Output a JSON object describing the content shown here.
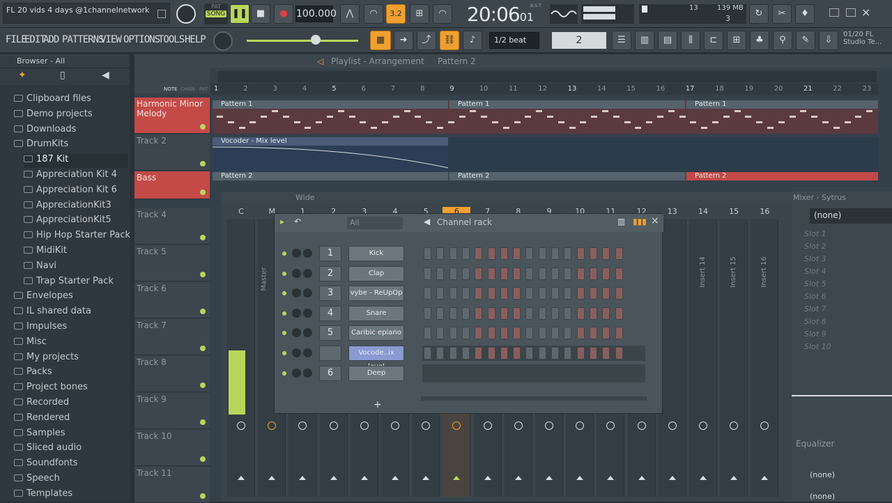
{
  "window": {
    "title": "FL 20 vids 4 days @1channelnetwork"
  },
  "transport": {
    "pat_label": "PAT",
    "song_label": "SONG",
    "tempo": "100.000",
    "time": "20:06",
    "time_sub": "01",
    "time_tiny": "B:S:T",
    "cpu_a": "13",
    "mem": "139 MB",
    "voices": "3"
  },
  "menu": {
    "items": [
      "FILE",
      "EDIT",
      "ADD",
      "PATTERNS",
      "VIEW",
      "OPTIONS",
      "TOOLS",
      "HELP"
    ]
  },
  "toolbar": {
    "snap": "1/2 beat",
    "step_value": "2",
    "news": "01/20  FL",
    "news2": "Studio Te..."
  },
  "browser": {
    "header": "Browser - All",
    "items": [
      {
        "label": "Clipboard files",
        "sub": false
      },
      {
        "label": "Demo projects",
        "sub": false
      },
      {
        "label": "Downloads",
        "sub": false
      },
      {
        "label": "DrumKits",
        "sub": false
      },
      {
        "label": "187 Kit",
        "sub": true
      },
      {
        "label": "Appreciation Kit 4",
        "sub": true
      },
      {
        "label": "Appreciation Kit 6",
        "sub": true
      },
      {
        "label": "AppreciationKit3",
        "sub": true
      },
      {
        "label": "AppreciationKit5",
        "sub": true
      },
      {
        "label": "Hip Hop Starter Pack",
        "sub": true
      },
      {
        "label": "MidiKit",
        "sub": true
      },
      {
        "label": "Navi",
        "sub": true
      },
      {
        "label": "Trap Starter Pack",
        "sub": true
      },
      {
        "label": "Envelopes",
        "sub": false
      },
      {
        "label": "IL shared data",
        "sub": false
      },
      {
        "label": "Impulses",
        "sub": false
      },
      {
        "label": "Misc",
        "sub": false
      },
      {
        "label": "My projects",
        "sub": false
      },
      {
        "label": "Packs",
        "sub": false
      },
      {
        "label": "Project bones",
        "sub": false
      },
      {
        "label": "Recorded",
        "sub": false
      },
      {
        "label": "Rendered",
        "sub": false
      },
      {
        "label": "Samples",
        "sub": false
      },
      {
        "label": "Sliced audio",
        "sub": false
      },
      {
        "label": "Soundfonts",
        "sub": false
      },
      {
        "label": "Speech",
        "sub": false
      },
      {
        "label": "Templates",
        "sub": false
      }
    ]
  },
  "playlist": {
    "title": "Playlist - Arrangement",
    "pattern": "Pattern 2",
    "ruler": [
      "1",
      "2",
      "3",
      "4",
      "5",
      "6",
      "7",
      "8",
      "9",
      "10",
      "11",
      "12",
      "13",
      "14",
      "15",
      "16",
      "17",
      "18",
      "19",
      "20",
      "21",
      "22",
      "23"
    ],
    "tabs": [
      "NOTE",
      "CHAN",
      "PAT"
    ],
    "tracks": [
      "Harmonic Minor Melody",
      "Track 2",
      "Bass",
      "Track 4",
      "Track 5",
      "Track 6",
      "Track 7",
      "Track 8",
      "Track 9",
      "Track 10",
      "Track 11"
    ],
    "clip_p1": "Pattern 1",
    "clip_p2": "Pattern 2",
    "clip_auto": "Vocoder - Mix level"
  },
  "mixer": {
    "view": "Wide",
    "headers": [
      "C",
      "M",
      "1",
      "2",
      "3",
      "4",
      "5",
      "6",
      "7",
      "8",
      "9",
      "10",
      "11",
      "12",
      "13",
      "14",
      "15",
      "16"
    ],
    "inserts": [
      "Master",
      "Insert 14",
      "Insert 15",
      "Insert 16"
    ],
    "right_title": "Mixer - Sytrus",
    "none": "(none)",
    "slots": [
      "Slot 1",
      "Slot 2",
      "Slot 3",
      "Slot 4",
      "Slot 5",
      "Slot 6",
      "Slot 7",
      "Slot 8",
      "Slot 9",
      "Slot 10"
    ],
    "equalizer": "Equalizer"
  },
  "channel_rack": {
    "title": "Channel rack",
    "filter": "All",
    "channels": [
      {
        "num": "1",
        "name": "Kick"
      },
      {
        "num": "2",
        "name": "Clap"
      },
      {
        "num": "3",
        "name": "vybe - ReUpOp"
      },
      {
        "num": "4",
        "name": "Snare"
      },
      {
        "num": "5",
        "name": "Caribic epiano"
      },
      {
        "num": "",
        "name": "Vocode..ix level"
      },
      {
        "num": "6",
        "name": "Deep"
      }
    ],
    "add": "+"
  },
  "colors": {
    "accent": "#f0a030",
    "track_red": "#c44a47",
    "led_green": "#b7d75a"
  }
}
